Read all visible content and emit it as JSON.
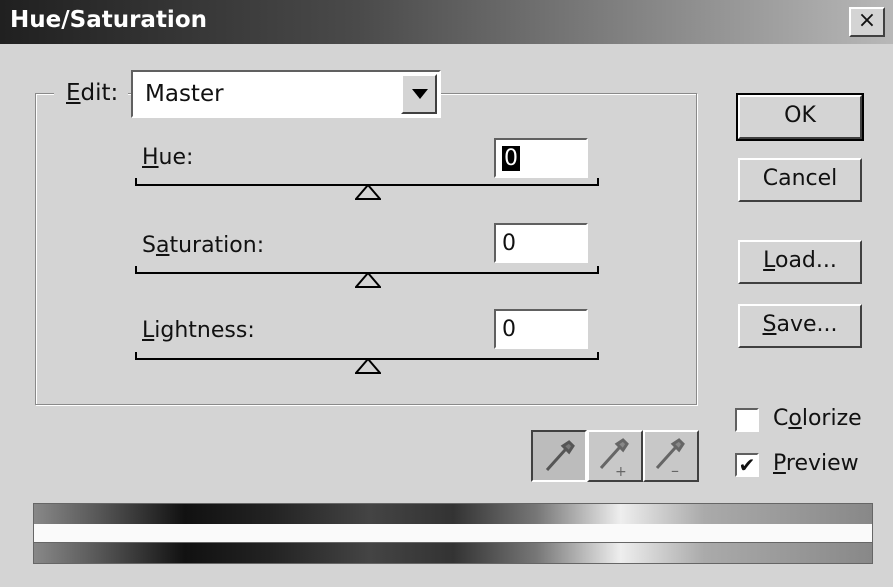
{
  "window": {
    "title": "Hue/Saturation",
    "close_glyph": "×"
  },
  "edit": {
    "label_prefix": "",
    "label_underline": "E",
    "label_rest": "dit:",
    "value": "Master"
  },
  "sliders": [
    {
      "label_underline": "H",
      "label_rest": "ue:",
      "value": "0",
      "position": 0.5
    },
    {
      "label_pre": "S",
      "label_underline": "a",
      "label_rest": "turation:",
      "value": "0",
      "position": 0.5
    },
    {
      "label_underline": "L",
      "label_rest": "ightness:",
      "value": "0",
      "position": 0.5
    }
  ],
  "buttons": {
    "ok": "OK",
    "cancel": "Cancel",
    "load_underline": "L",
    "load_rest": "oad...",
    "save_underline": "S",
    "save_rest": "ave..."
  },
  "checkboxes": {
    "colorize": {
      "pre": "C",
      "underline": "o",
      "rest": "lorize",
      "checked": false
    },
    "preview": {
      "underline": "P",
      "rest": "review",
      "checked": true,
      "mark": "✔"
    }
  },
  "eyedroppers": [
    "eyedropper-icon",
    "eyedropper-plus-icon",
    "eyedropper-minus-icon"
  ],
  "colors": {
    "dialog_bg": "#d4d4d4",
    "title_start": "#202020",
    "title_end": "#b8b8b8"
  }
}
